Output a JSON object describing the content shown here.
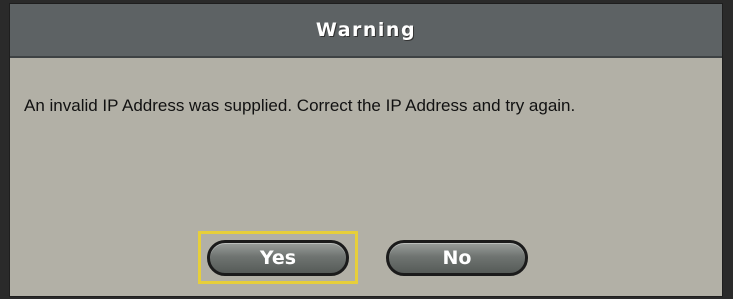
{
  "dialog": {
    "title": "Warning",
    "message": "An invalid IP Address was supplied. Correct the IP Address and try again.",
    "buttons": {
      "yes_label": "Yes",
      "no_label": "No"
    },
    "focused_button": "Yes"
  },
  "colors": {
    "titlebar": "#5d6264",
    "body": "#b2b0a6",
    "focus_ring": "#e7cf3a",
    "button": "#6f7471"
  }
}
